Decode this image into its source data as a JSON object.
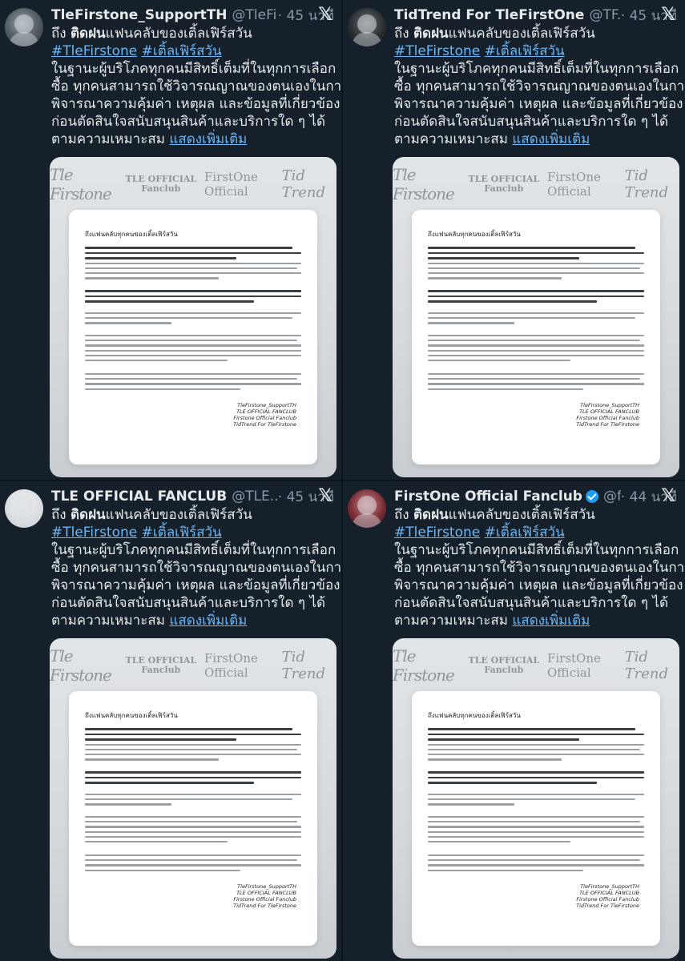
{
  "tweets": [
    {
      "name": "TleFirstone_SupportTH",
      "handle": "@TleFi...",
      "time": "· 45 นาที",
      "verified": false,
      "avatar_icon": "profile-photo"
    },
    {
      "name": "TidTrend For TleFirstOne",
      "handle": "@TF...",
      "time": "· 45 นาที",
      "verified": false,
      "avatar_icon": "profile-photo"
    },
    {
      "name": "TLE OFFICIAL FANCLUB",
      "handle": "@TLE...",
      "time": "· 45 นาที",
      "verified": false,
      "avatar_icon": "profile-photo"
    },
    {
      "name": "FirstOne Official Fanclub",
      "handle": "@fi...",
      "time": "· 44 นาที",
      "verified": true,
      "avatar_icon": "profile-photo"
    }
  ],
  "post": {
    "greeting_prefix": "ถึง",
    "greeting_bold": "ติดฝน",
    "greeting_rest": "แฟนคลับของเติ้ลเฟิร์สวัน",
    "hashtag1": "#TleFirstone",
    "hashtag2": "#เติ้ลเฟิร์สวัน",
    "line1": "ในฐานะผู้บริโภคทุกคนมีสิทธิ์เต็มที่ในทุกการเลือก",
    "line2": "ซื้อ ทุกคนสามารถใช้วิจารณญาณของตนเองในการ",
    "line3": "พิจารณาความคุ้มค่า เหตุผล และข้อมูลที่เกี่ยวข้อง",
    "line4": "ก่อนตัดสินใจสนับสนุนสินค้าและบริการใด ๆ ได้",
    "line5": "ตามความเหมาะสม",
    "show_more": "แสดงเพิ่มเติม"
  },
  "letter": {
    "logo1": "Tle Firstone",
    "logo2": "TLE OFFICIAL Fanclub",
    "logo3": "FirstOne Official",
    "logo4": "Tid Trend",
    "greeting": "ถึงแฟนคลับทุกคนของเติ้ลเฟิร์สวัน",
    "signatures": [
      "TleFirstone_SupportTH",
      "TLE OFFICIAL FANCLUB",
      "Firstone Official Fanclub",
      "TidTrend For TleFirstone"
    ]
  },
  "colors": {
    "background": "#15202b",
    "link": "#6cb6f5",
    "verified": "#1d9bf0",
    "muted": "#8b98a5"
  },
  "icons": {
    "platform": "x-logo-icon",
    "verified": "verified-badge-icon"
  }
}
